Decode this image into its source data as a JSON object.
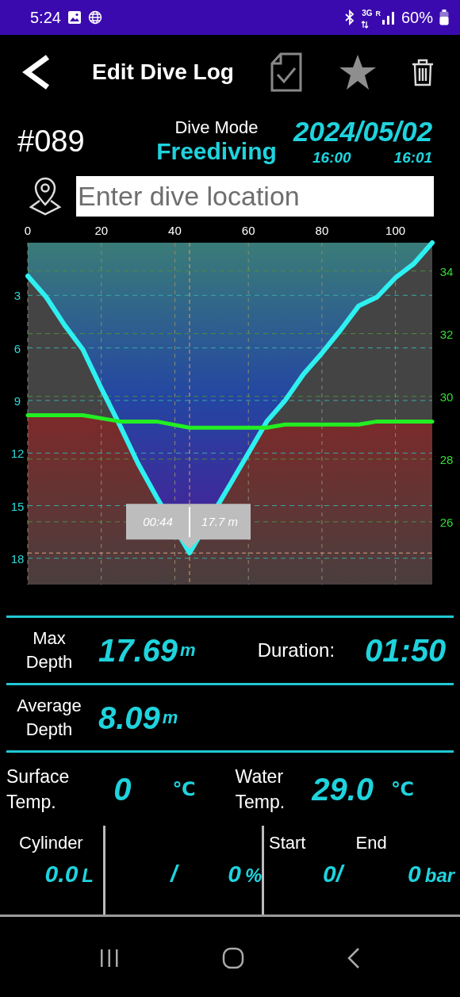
{
  "status_bar": {
    "time": "5:24",
    "network": "3G",
    "roaming": "R",
    "battery": "60%"
  },
  "header": {
    "title": "Edit Dive Log"
  },
  "dive": {
    "number": "#089",
    "mode_label": "Dive Mode",
    "mode": "Freediving",
    "date": "2024/05/02",
    "start_time": "16:00",
    "end_time": "16:01"
  },
  "location": {
    "placeholder": "Enter dive location"
  },
  "profile": {
    "tooltip": {
      "time": "00:44",
      "depth": "17.7 m"
    },
    "chart_data": {
      "type": "area",
      "grid": true,
      "ref_lines": [
        {
          "axis": "x",
          "value": 44,
          "color": "#e0a060"
        },
        {
          "axis": "y",
          "value": 17.7,
          "color": "#e0a080"
        }
      ],
      "x": [
        0,
        5,
        10,
        15,
        20,
        25,
        30,
        35,
        44,
        55,
        60,
        65,
        70,
        75,
        80,
        85,
        90,
        95,
        100,
        105,
        110
      ],
      "series": [
        {
          "color": "#2ef0f0",
          "values": [
            1.9,
            3.1,
            4.7,
            6.1,
            8.3,
            10.4,
            12.6,
            14.5,
            17.7,
            13.8,
            12.0,
            10.2,
            9.0,
            7.5,
            6.3,
            5.0,
            3.6,
            3.1,
            2.0,
            1.2,
            0.0
          ]
        },
        {
          "color": "#22ee22",
          "axis": "y2",
          "values": [
            29.4,
            29.4,
            29.4,
            29.4,
            29.3,
            29.2,
            29.2,
            29.2,
            29.0,
            29.0,
            29.0,
            29.0,
            29.1,
            29.1,
            29.1,
            29.1,
            29.1,
            29.2,
            29.2,
            29.2,
            29.2
          ]
        }
      ],
      "xlim": [
        0,
        110
      ],
      "xticks": [
        0,
        20,
        40,
        60,
        80,
        100
      ],
      "ylim": [
        19.5,
        0
      ],
      "yticks": [
        3,
        6,
        9,
        12,
        15,
        18
      ],
      "y2lim": [
        24.0,
        34.9
      ],
      "y2ticks": [
        26,
        28,
        30,
        32,
        34
      ]
    }
  },
  "stats": [
    {
      "label": "Max Depth",
      "value": "17.69",
      "unit": "m"
    },
    {
      "label": "Duration:",
      "value": "01:50"
    },
    {
      "label": "Average Depth",
      "value": "8.09",
      "unit": "m"
    }
  ],
  "temperatures": [
    {
      "label": "Surface Temp.",
      "value": "0",
      "unit": "℃"
    },
    {
      "label": "Water Temp.",
      "value": "29.0",
      "unit": "℃"
    }
  ],
  "cylinder": {
    "label": "Cylinder",
    "volume": "0.0",
    "volume_unit": "L",
    "separator": "/",
    "mix": "0",
    "mix_unit": "%",
    "start_label": "Start",
    "end_label": "End",
    "start": "0/",
    "end": "0",
    "pressure_unit": "bar"
  }
}
